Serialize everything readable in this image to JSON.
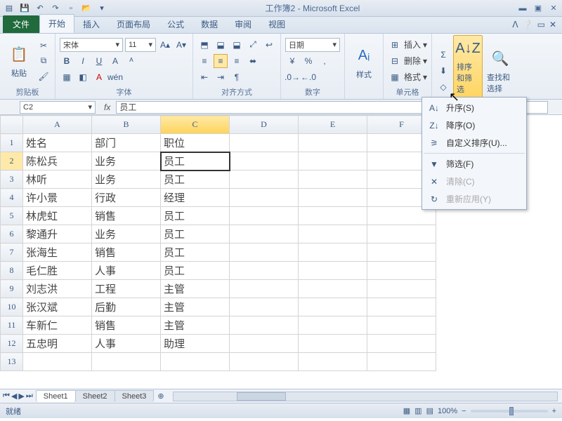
{
  "app": {
    "title": "工作簿2 - Microsoft Excel"
  },
  "tabs": {
    "file": "文件",
    "home": "开始",
    "insert": "插入",
    "layout": "页面布局",
    "formulas": "公式",
    "data": "数据",
    "review": "审阅",
    "view": "视图"
  },
  "ribbon": {
    "clipboard": {
      "paste": "粘贴",
      "label": "剪贴板"
    },
    "font": {
      "name": "宋体",
      "size": "11",
      "label": "字体"
    },
    "align": {
      "label": "对齐方式"
    },
    "number": {
      "format": "日期",
      "label": "数字"
    },
    "styles": {
      "big": "样式"
    },
    "cells": {
      "insert": "插入",
      "delete": "删除",
      "format": "格式",
      "label": "单元格"
    },
    "editing": {
      "sort": "排序和筛选",
      "find": "查找和选择"
    }
  },
  "formula": {
    "cell": "C2",
    "value": "员工"
  },
  "columns": [
    "A",
    "B",
    "C",
    "D",
    "E",
    "F"
  ],
  "rows": [
    {
      "n": 1,
      "A": "姓名",
      "B": "部门",
      "C": "职位"
    },
    {
      "n": 2,
      "A": "陈松兵",
      "B": "业务",
      "C": "员工"
    },
    {
      "n": 3,
      "A": "林听",
      "B": "业务",
      "C": "员工"
    },
    {
      "n": 4,
      "A": "许小景",
      "B": "行政",
      "C": "经理"
    },
    {
      "n": 5,
      "A": "林虎虹",
      "B": "销售",
      "C": "员工"
    },
    {
      "n": 6,
      "A": "黎通升",
      "B": "业务",
      "C": "员工"
    },
    {
      "n": 7,
      "A": "张海生",
      "B": "销售",
      "C": "员工"
    },
    {
      "n": 8,
      "A": "毛仁胜",
      "B": "人事",
      "C": "员工"
    },
    {
      "n": 9,
      "A": "刘志洪",
      "B": "工程",
      "C": "主管"
    },
    {
      "n": 10,
      "A": "张汉斌",
      "B": "后勤",
      "C": "主管"
    },
    {
      "n": 11,
      "A": "车新仁",
      "B": "销售",
      "C": "主管"
    },
    {
      "n": 12,
      "A": "五忠明",
      "B": "人事",
      "C": "助理"
    },
    {
      "n": 13,
      "A": "",
      "B": "",
      "C": ""
    }
  ],
  "menu": {
    "asc": "升序(S)",
    "desc": "降序(O)",
    "custom": "自定义排序(U)...",
    "filter": "筛选(F)",
    "clear": "清除(C)",
    "reapply": "重新应用(Y)"
  },
  "sheets": {
    "s1": "Sheet1",
    "s2": "Sheet2",
    "s3": "Sheet3"
  },
  "status": {
    "ready": "就绪",
    "zoom": "100%"
  }
}
